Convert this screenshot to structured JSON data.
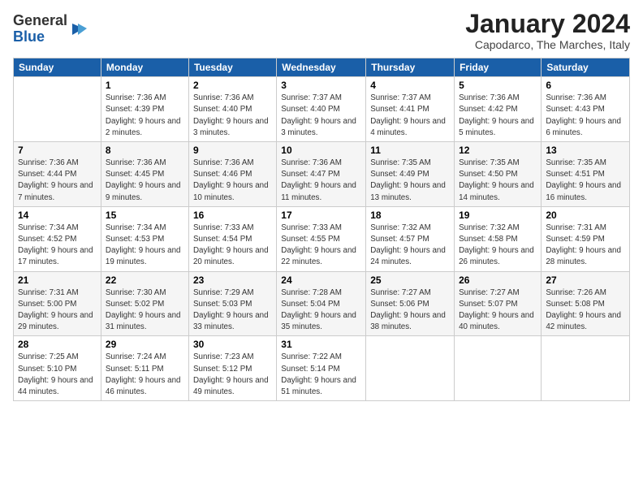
{
  "logo": {
    "general": "General",
    "blue": "Blue"
  },
  "header": {
    "title": "January 2024",
    "location": "Capodarco, The Marches, Italy"
  },
  "days_of_week": [
    "Sunday",
    "Monday",
    "Tuesday",
    "Wednesday",
    "Thursday",
    "Friday",
    "Saturday"
  ],
  "weeks": [
    [
      {
        "num": "",
        "info": ""
      },
      {
        "num": "1",
        "info": "Sunrise: 7:36 AM\nSunset: 4:39 PM\nDaylight: 9 hours\nand 2 minutes."
      },
      {
        "num": "2",
        "info": "Sunrise: 7:36 AM\nSunset: 4:40 PM\nDaylight: 9 hours\nand 3 minutes."
      },
      {
        "num": "3",
        "info": "Sunrise: 7:37 AM\nSunset: 4:40 PM\nDaylight: 9 hours\nand 3 minutes."
      },
      {
        "num": "4",
        "info": "Sunrise: 7:37 AM\nSunset: 4:41 PM\nDaylight: 9 hours\nand 4 minutes."
      },
      {
        "num": "5",
        "info": "Sunrise: 7:36 AM\nSunset: 4:42 PM\nDaylight: 9 hours\nand 5 minutes."
      },
      {
        "num": "6",
        "info": "Sunrise: 7:36 AM\nSunset: 4:43 PM\nDaylight: 9 hours\nand 6 minutes."
      }
    ],
    [
      {
        "num": "7",
        "info": "Sunrise: 7:36 AM\nSunset: 4:44 PM\nDaylight: 9 hours\nand 7 minutes."
      },
      {
        "num": "8",
        "info": "Sunrise: 7:36 AM\nSunset: 4:45 PM\nDaylight: 9 hours\nand 9 minutes."
      },
      {
        "num": "9",
        "info": "Sunrise: 7:36 AM\nSunset: 4:46 PM\nDaylight: 9 hours\nand 10 minutes."
      },
      {
        "num": "10",
        "info": "Sunrise: 7:36 AM\nSunset: 4:47 PM\nDaylight: 9 hours\nand 11 minutes."
      },
      {
        "num": "11",
        "info": "Sunrise: 7:35 AM\nSunset: 4:49 PM\nDaylight: 9 hours\nand 13 minutes."
      },
      {
        "num": "12",
        "info": "Sunrise: 7:35 AM\nSunset: 4:50 PM\nDaylight: 9 hours\nand 14 minutes."
      },
      {
        "num": "13",
        "info": "Sunrise: 7:35 AM\nSunset: 4:51 PM\nDaylight: 9 hours\nand 16 minutes."
      }
    ],
    [
      {
        "num": "14",
        "info": "Sunrise: 7:34 AM\nSunset: 4:52 PM\nDaylight: 9 hours\nand 17 minutes."
      },
      {
        "num": "15",
        "info": "Sunrise: 7:34 AM\nSunset: 4:53 PM\nDaylight: 9 hours\nand 19 minutes."
      },
      {
        "num": "16",
        "info": "Sunrise: 7:33 AM\nSunset: 4:54 PM\nDaylight: 9 hours\nand 20 minutes."
      },
      {
        "num": "17",
        "info": "Sunrise: 7:33 AM\nSunset: 4:55 PM\nDaylight: 9 hours\nand 22 minutes."
      },
      {
        "num": "18",
        "info": "Sunrise: 7:32 AM\nSunset: 4:57 PM\nDaylight: 9 hours\nand 24 minutes."
      },
      {
        "num": "19",
        "info": "Sunrise: 7:32 AM\nSunset: 4:58 PM\nDaylight: 9 hours\nand 26 minutes."
      },
      {
        "num": "20",
        "info": "Sunrise: 7:31 AM\nSunset: 4:59 PM\nDaylight: 9 hours\nand 28 minutes."
      }
    ],
    [
      {
        "num": "21",
        "info": "Sunrise: 7:31 AM\nSunset: 5:00 PM\nDaylight: 9 hours\nand 29 minutes."
      },
      {
        "num": "22",
        "info": "Sunrise: 7:30 AM\nSunset: 5:02 PM\nDaylight: 9 hours\nand 31 minutes."
      },
      {
        "num": "23",
        "info": "Sunrise: 7:29 AM\nSunset: 5:03 PM\nDaylight: 9 hours\nand 33 minutes."
      },
      {
        "num": "24",
        "info": "Sunrise: 7:28 AM\nSunset: 5:04 PM\nDaylight: 9 hours\nand 35 minutes."
      },
      {
        "num": "25",
        "info": "Sunrise: 7:27 AM\nSunset: 5:06 PM\nDaylight: 9 hours\nand 38 minutes."
      },
      {
        "num": "26",
        "info": "Sunrise: 7:27 AM\nSunset: 5:07 PM\nDaylight: 9 hours\nand 40 minutes."
      },
      {
        "num": "27",
        "info": "Sunrise: 7:26 AM\nSunset: 5:08 PM\nDaylight: 9 hours\nand 42 minutes."
      }
    ],
    [
      {
        "num": "28",
        "info": "Sunrise: 7:25 AM\nSunset: 5:10 PM\nDaylight: 9 hours\nand 44 minutes."
      },
      {
        "num": "29",
        "info": "Sunrise: 7:24 AM\nSunset: 5:11 PM\nDaylight: 9 hours\nand 46 minutes."
      },
      {
        "num": "30",
        "info": "Sunrise: 7:23 AM\nSunset: 5:12 PM\nDaylight: 9 hours\nand 49 minutes."
      },
      {
        "num": "31",
        "info": "Sunrise: 7:22 AM\nSunset: 5:14 PM\nDaylight: 9 hours\nand 51 minutes."
      },
      {
        "num": "",
        "info": ""
      },
      {
        "num": "",
        "info": ""
      },
      {
        "num": "",
        "info": ""
      }
    ]
  ]
}
